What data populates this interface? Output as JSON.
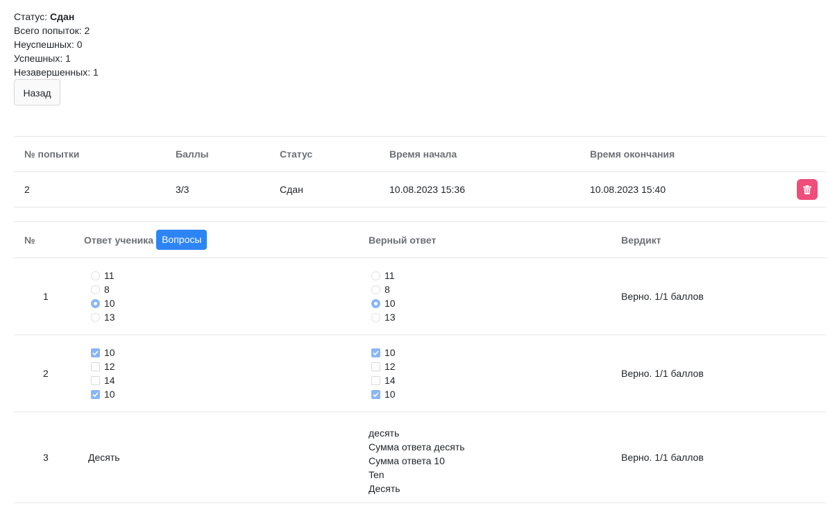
{
  "summary": {
    "status_label": "Статус: ",
    "status_value": "Сдан",
    "total": "Всего попыток: 2",
    "failed": "Неуспешных: 0",
    "success": "Успешных: 1",
    "unfinished": "Незавершенных: 1"
  },
  "back_button": "Назад",
  "attempts": {
    "headers": [
      "№ попытки",
      "Баллы",
      "Статус",
      "Время начала",
      "Время окончания"
    ],
    "rows": [
      {
        "number": "2",
        "score": "3/3",
        "status": "Сдан",
        "start": "10.08.2023 15:36",
        "end": "10.08.2023 15:40"
      }
    ]
  },
  "answers": {
    "headers": {
      "num": "№",
      "student": "Ответ ученика",
      "questions_button": "Вопросы",
      "correct": "Верный ответ",
      "verdict": "Вердикт"
    },
    "rows": [
      {
        "num": "1",
        "type": "radio",
        "options": [
          "11",
          "8",
          "10",
          "13"
        ],
        "student_selected": [
          false,
          false,
          true,
          false
        ],
        "correct_selected": [
          false,
          false,
          true,
          false
        ],
        "verdict": "Верно. 1/1 баллов"
      },
      {
        "num": "2",
        "type": "checkbox",
        "options": [
          "10",
          "12",
          "14",
          "10"
        ],
        "student_selected": [
          true,
          false,
          false,
          true
        ],
        "correct_selected": [
          true,
          false,
          false,
          true
        ],
        "verdict": "Верно. 1/1 баллов"
      },
      {
        "num": "3",
        "type": "text",
        "student_text": "Десять",
        "correct_texts": [
          "десять",
          "Сумма ответа десять",
          "Сумма ответа 10",
          "Ten",
          "Десять"
        ],
        "verdict": "Верно. 1/1 баллов"
      }
    ]
  },
  "colors": {
    "accent": "#2d84f5",
    "danger": "#ee4e7a",
    "selected": "#8ab6f7"
  },
  "icons": {
    "delete": "trash-icon",
    "check": "check-icon"
  }
}
